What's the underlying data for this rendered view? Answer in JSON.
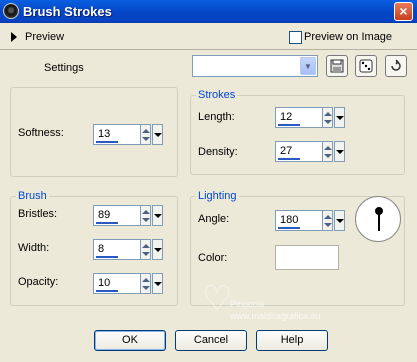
{
  "window": {
    "title": "Brush Strokes",
    "close_glyph": "×",
    "icon": "paint-app-icon"
  },
  "preview_bar": {
    "preview_label": "Preview",
    "preview_on_image_label": "Preview on Image",
    "preview_on_image_checked": false
  },
  "settings": {
    "label": "Settings",
    "selected": "",
    "buttons": [
      "save-preset-icon",
      "randomize-dice-icon",
      "reset-icon"
    ]
  },
  "softness": {
    "label": "Softness:",
    "value": "13"
  },
  "strokes": {
    "title": "Strokes",
    "length": {
      "label": "Length:",
      "value": "12"
    },
    "density": {
      "label": "Density:",
      "value": "27"
    }
  },
  "brush": {
    "title": "Brush",
    "bristles": {
      "label": "Bristles:",
      "value": "89"
    },
    "width": {
      "label": "Width:",
      "value": "8"
    },
    "opacity": {
      "label": "Opacity:",
      "value": "10"
    }
  },
  "lighting": {
    "title": "Lighting",
    "angle": {
      "label": "Angle:",
      "value": "180"
    },
    "color": {
      "label": "Color:",
      "hex": "#ffffff"
    }
  },
  "watermark": {
    "line1": "Pinuccia",
    "line2": "www.maldiragrafica.eu"
  },
  "buttons": {
    "ok": "OK",
    "cancel": "Cancel",
    "help": "Help"
  },
  "colors": {
    "titlebar": "#0446c7",
    "group_title": "#0046d5",
    "background": "#ece9d8"
  }
}
